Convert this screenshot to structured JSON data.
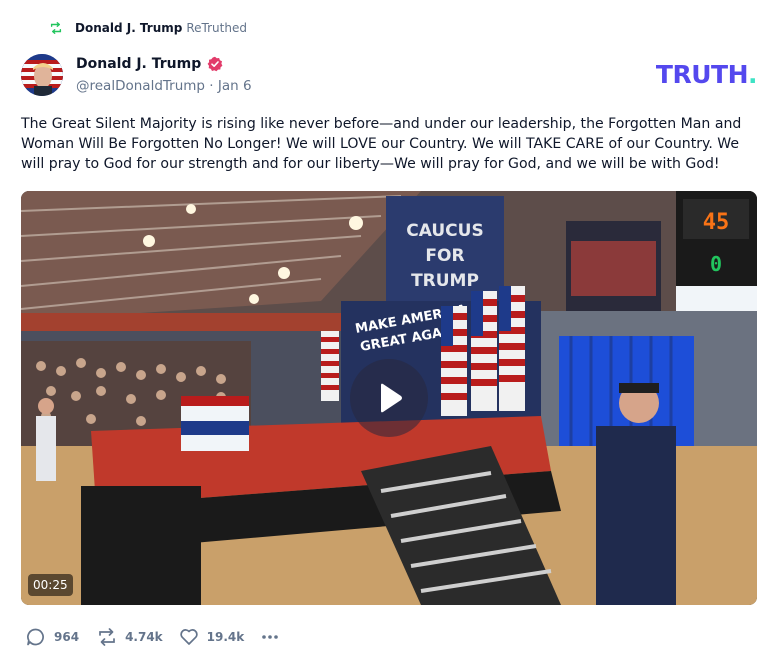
{
  "retruth_bar": {
    "author": "Donald J. Trump",
    "action": "ReTruthed",
    "icon": "retruth-icon"
  },
  "author": {
    "name": "Donald J. Trump",
    "verified_icon": "verified-badge-icon",
    "handle": "@realDonaldTrump · Jan 6",
    "avatar_icon": "avatar-image"
  },
  "brand": {
    "logo_text": "TRUTH",
    "logo_dot": ".",
    "logo_color": "#5448ee",
    "logo_dot_color": "#3ee3c5"
  },
  "post": {
    "text": "The Great Silent Majority is rising like never before—and under our leadership, the Forgotten Man and Woman Will Be Forgotten No Longer! We will LOVE our Country. We will TAKE CARE of our Country. We will pray to God for our strength and for our liberty—We will pray for God, and we will be with God!"
  },
  "video": {
    "duration": "00:25",
    "play_icon": "play-icon"
  },
  "actions": {
    "replies": "964",
    "retruths": "4.74k",
    "likes": "19.4k",
    "more_icon": "more-icon"
  },
  "colors": {
    "text": "#0f172a",
    "muted": "#64748b",
    "verified": "#e23b6a",
    "retruth_icon": "#22c55e"
  }
}
